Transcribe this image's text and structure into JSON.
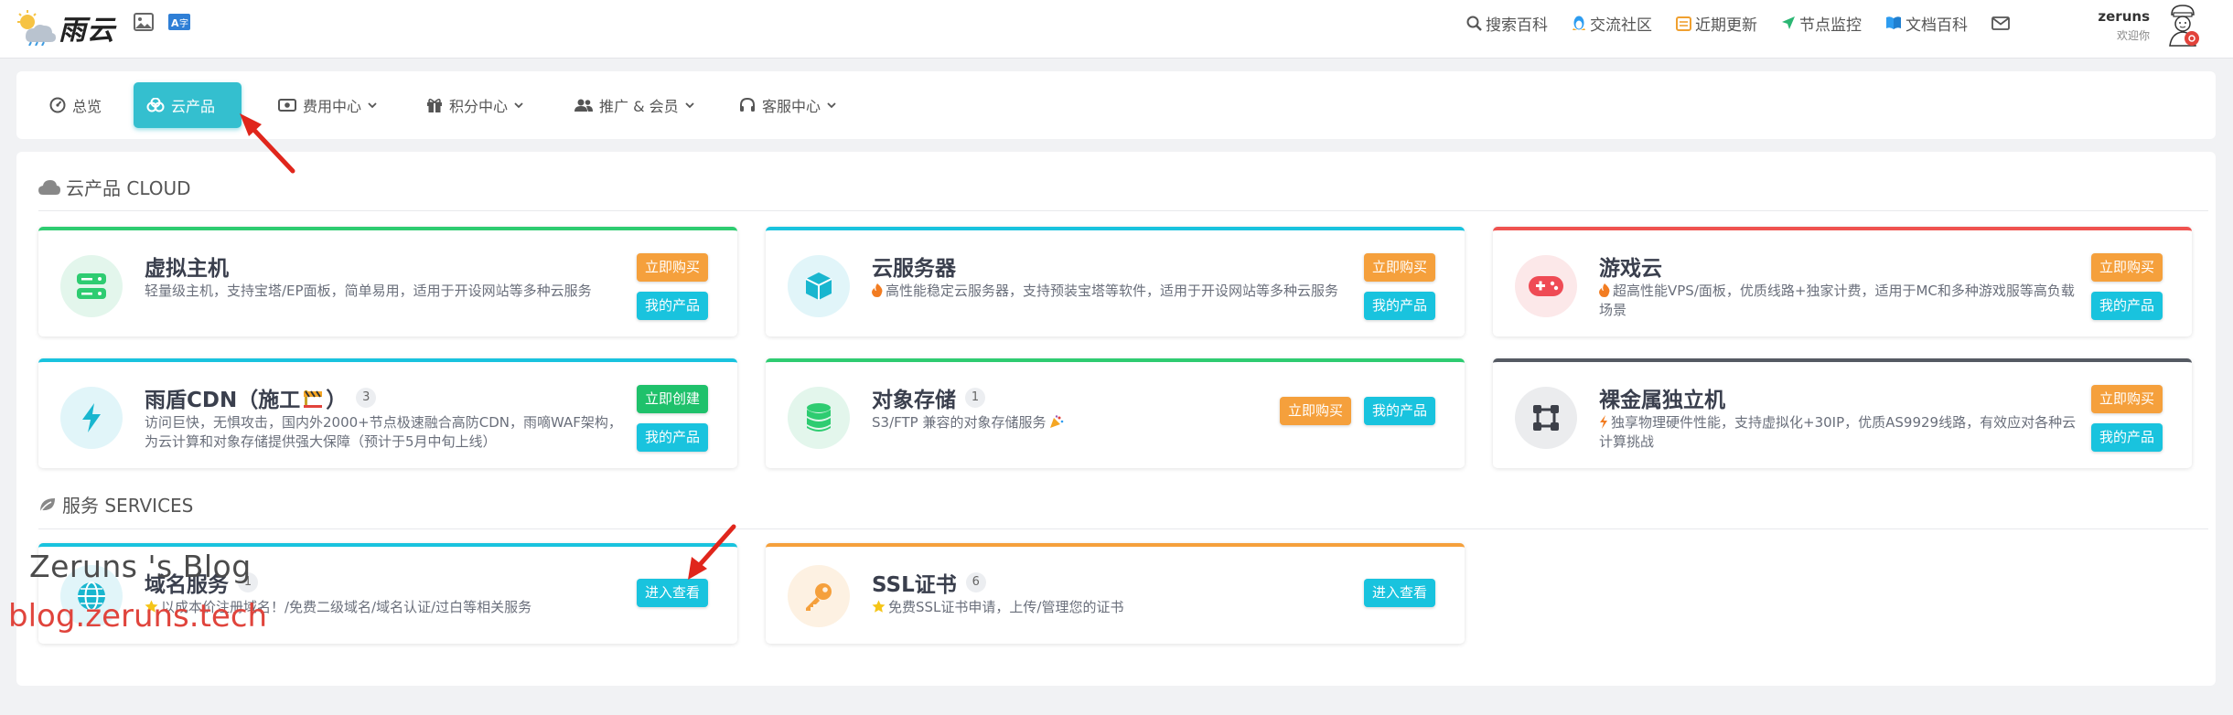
{
  "header": {
    "brand": "雨云",
    "nav": [
      {
        "label": "搜索百科",
        "icon": "search-icon"
      },
      {
        "label": "交流社区",
        "icon": "qq-penguin-icon"
      },
      {
        "label": "近期更新",
        "icon": "update-list-icon"
      },
      {
        "label": "节点监控",
        "icon": "location-arrow-icon"
      },
      {
        "label": "文档百科",
        "icon": "book-icon"
      }
    ],
    "user": {
      "name": "zeruns",
      "greeting": "欢迎你"
    }
  },
  "tabs": [
    {
      "label": "总览",
      "icon": "dashboard-icon",
      "active": false,
      "dropdown": false
    },
    {
      "label": "云产品",
      "icon": "cloud-products-icon",
      "active": true,
      "dropdown": false
    },
    {
      "label": "费用中心",
      "icon": "money-icon",
      "active": false,
      "dropdown": true
    },
    {
      "label": "积分中心",
      "icon": "gift-icon",
      "active": false,
      "dropdown": true
    },
    {
      "label": "推广 & 会员",
      "icon": "users-icon",
      "active": false,
      "dropdown": true
    },
    {
      "label": "客服中心",
      "icon": "headset-icon",
      "active": false,
      "dropdown": true
    }
  ],
  "sections": {
    "cloud": {
      "title": "云产品 CLOUD"
    },
    "services": {
      "title": "服务 SERVICES"
    }
  },
  "cards": [
    {
      "title": "虚拟主机",
      "desc": "轻量级主机，支持宝塔/EP面板，简单易用，适用于开设网站等多种云服务",
      "lead_icon": "",
      "badge": "",
      "accent": "#2ecc71",
      "icon_name": "server-icon",
      "icon_bg": "#e3f6ec",
      "buttons": [
        "立即购买",
        "我的产品"
      ]
    },
    {
      "title": "云服务器",
      "desc": "高性能稳定云服务器，支持预装宝塔等软件，适用于开设网站等多种云服务",
      "lead_icon": "fire-icon",
      "badge": "",
      "accent": "#19c3de",
      "icon_name": "cube-icon",
      "icon_bg": "#e1f5f9",
      "buttons": [
        "立即购买",
        "我的产品"
      ]
    },
    {
      "title": "游戏云",
      "desc": "超高性能VPS/面板，优质线路+独家计费，适用于MC和多种游戏服等高负载场景",
      "lead_icon": "fire-icon",
      "badge": "",
      "accent": "#ef5350",
      "icon_name": "gamepad-icon",
      "icon_bg": "#fce8e9",
      "buttons": [
        "立即购买",
        "我的产品"
      ]
    },
    {
      "title": "雨盾CDN（施工",
      "title_suffix": "）",
      "desc": "访问巨快，无惧攻击，国内外2000+节点极速融合高防CDN，雨嘀WAF架构，为云计算和对象存储提供强大保障（预计于5月中旬上线）",
      "lead_icon": "",
      "badge": "3",
      "accent": "#19c3de",
      "icon_name": "lightning-icon",
      "icon_bg": "#e1f5f9",
      "buttons": [
        "立即创建",
        "我的产品"
      ]
    },
    {
      "title": "对象存储",
      "desc": "S3/FTP 兼容的对象存储服务",
      "lead_icon": "",
      "badge": "1",
      "accent": "#2ecc71",
      "icon_name": "database-icon",
      "icon_bg": "#e3f6ec",
      "buttons": [
        "立即购买",
        "我的产品"
      ]
    },
    {
      "title": "裸金属独立机",
      "desc": "独享物理硬件性能，支持虚拟化+30IP，优质AS9929线路，有效应对各种云计算挑战",
      "lead_icon": "bolt-icon",
      "badge": "",
      "accent": "#555a63",
      "icon_name": "bare-metal-icon",
      "icon_bg": "#ebecee",
      "buttons": [
        "立即购买",
        "我的产品"
      ]
    },
    {
      "title": "域名服务",
      "desc": "以成本价注册域名！/免费二级域名/域名认证/过白等相关服务",
      "lead_icon": "star-icon",
      "badge": "1",
      "accent": "#19c3de",
      "icon_name": "globe-icon",
      "icon_bg": "#e1f5f9",
      "buttons": [
        "进入查看"
      ]
    },
    {
      "title": "SSL证书",
      "desc": "免费SSL证书申请，上传/管理您的证书",
      "lead_icon": "star-icon",
      "badge": "6",
      "accent": "#f5a03c",
      "icon_name": "key-icon",
      "icon_bg": "#fdf1e2",
      "buttons": [
        "进入查看"
      ]
    }
  ],
  "watermark": {
    "line1": "Zeruns 's Blog",
    "line2": "blog.zeruns.tech"
  },
  "colors": {
    "accent_cyan": "#34bfcf",
    "buy_orange": "#f5a03c",
    "mine_cyan": "#19c3de",
    "create_green": "#1fc16b",
    "annotation_red": "#e0261c"
  }
}
